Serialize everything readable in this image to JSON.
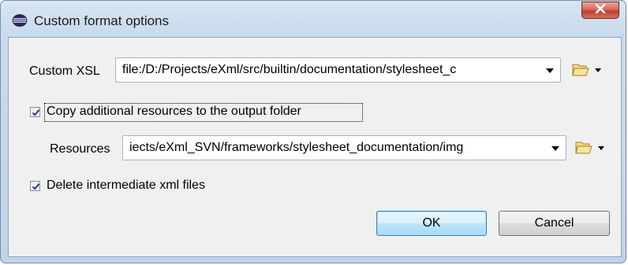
{
  "window": {
    "title": "Custom format options",
    "close_glyph": "X"
  },
  "custom_xsl": {
    "label": "Custom XSL",
    "value": "file:/D:/Projects/eXml/src/builtin/documentation/stylesheet_c",
    "folder_icon": "folder-icon",
    "menu_icon": "dropdown-arrow-icon"
  },
  "copy_resources": {
    "label": "Copy additional resources to the output folder",
    "checked": true
  },
  "resources": {
    "label": "Resources",
    "value": "iects/eXml_SVN/frameworks/stylesheet_documentation/img",
    "folder_icon": "folder-icon",
    "menu_icon": "dropdown-arrow-icon"
  },
  "delete_intermediate": {
    "label": "Delete intermediate xml files",
    "checked": true
  },
  "buttons": {
    "ok": "OK",
    "cancel": "Cancel"
  },
  "colors": {
    "accent": "#3c7fb1",
    "close": "#c0402c",
    "folder": "#e8c050"
  }
}
